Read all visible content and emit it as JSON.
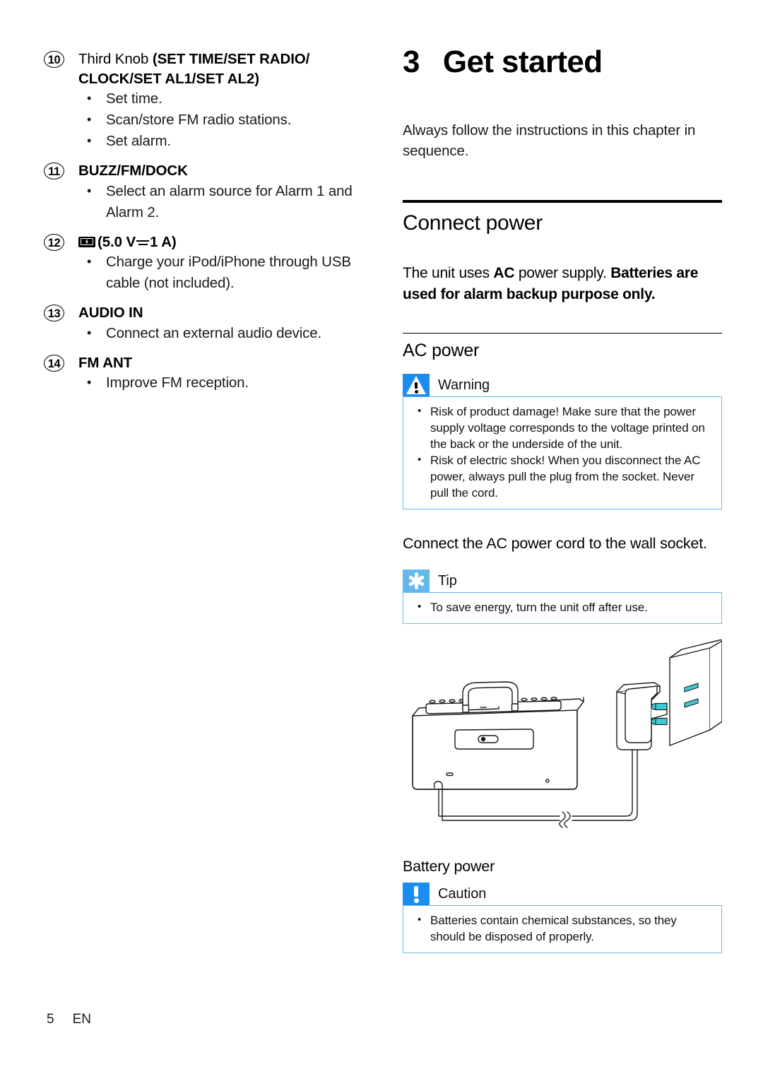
{
  "colors": {
    "warning_blue": "#1b8cf0",
    "tip_blue": "#63b8ec",
    "note_border": "#6cb8e8",
    "socket_teal": "#39c8d0"
  },
  "left_column": {
    "items": [
      {
        "number": "10",
        "title_regular": "Third Knob ",
        "title_bold": "(SET TIME/SET RADIO/ CLOCK/SET AL1/SET AL2)",
        "bullets": [
          "Set time.",
          "Scan/store FM radio stations.",
          "Set alarm."
        ]
      },
      {
        "number": "11",
        "title_bold": "BUZZ/FM/DOCK",
        "bullets": [
          "Select an alarm source for Alarm 1 and Alarm 2."
        ]
      },
      {
        "number": "12",
        "icon": "usb-charge-icon",
        "title_bold": "(5.0 V ⎓ 1 A)",
        "title_prefix": "(5.0 V",
        "title_suffix": "1 A)",
        "bullets": [
          "Charge your iPod/iPhone through USB cable (not included)."
        ]
      },
      {
        "number": "13",
        "title_bold": "AUDIO IN",
        "bullets": [
          "Connect an external audio device."
        ]
      },
      {
        "number": "14",
        "title_bold": "FM ANT",
        "bullets": [
          "Improve FM reception."
        ]
      }
    ]
  },
  "right_column": {
    "chapter_number": "3",
    "chapter_title": "Get started",
    "intro": "Always follow the instructions in this chapter in sequence.",
    "section_heading": "Connect power",
    "section_intro_part1": "The unit uses ",
    "section_intro_ac": "AC",
    "section_intro_part2": " power supply. ",
    "section_intro_part3": "Batteries are used for alarm backup purpose only.",
    "ac_power_heading": "AC power",
    "warning": {
      "icon": "warning-triangle-icon",
      "title": "Warning",
      "bullets": [
        "Risk of product damage! Make sure that the power supply voltage corresponds to the voltage printed on the back or the underside of the unit.",
        "Risk of electric shock! When you disconnect the AC power, always pull the plug from the socket. Never pull the cord."
      ]
    },
    "instruction": "Connect the AC power cord to the wall socket.",
    "tip": {
      "icon": "tip-star-icon",
      "title": "Tip",
      "bullets": [
        "To save energy, turn the unit off after use."
      ]
    },
    "illustration": {
      "name": "speaker-dock-ac-adapter-wall-socket-diagram"
    },
    "battery_power_heading": "Battery power",
    "caution": {
      "icon": "caution-exclamation-icon",
      "title": "Caution",
      "bullets": [
        "Batteries contain chemical substances, so they should be disposed of properly."
      ]
    }
  },
  "footer": {
    "page_number": "5",
    "language": "EN"
  }
}
